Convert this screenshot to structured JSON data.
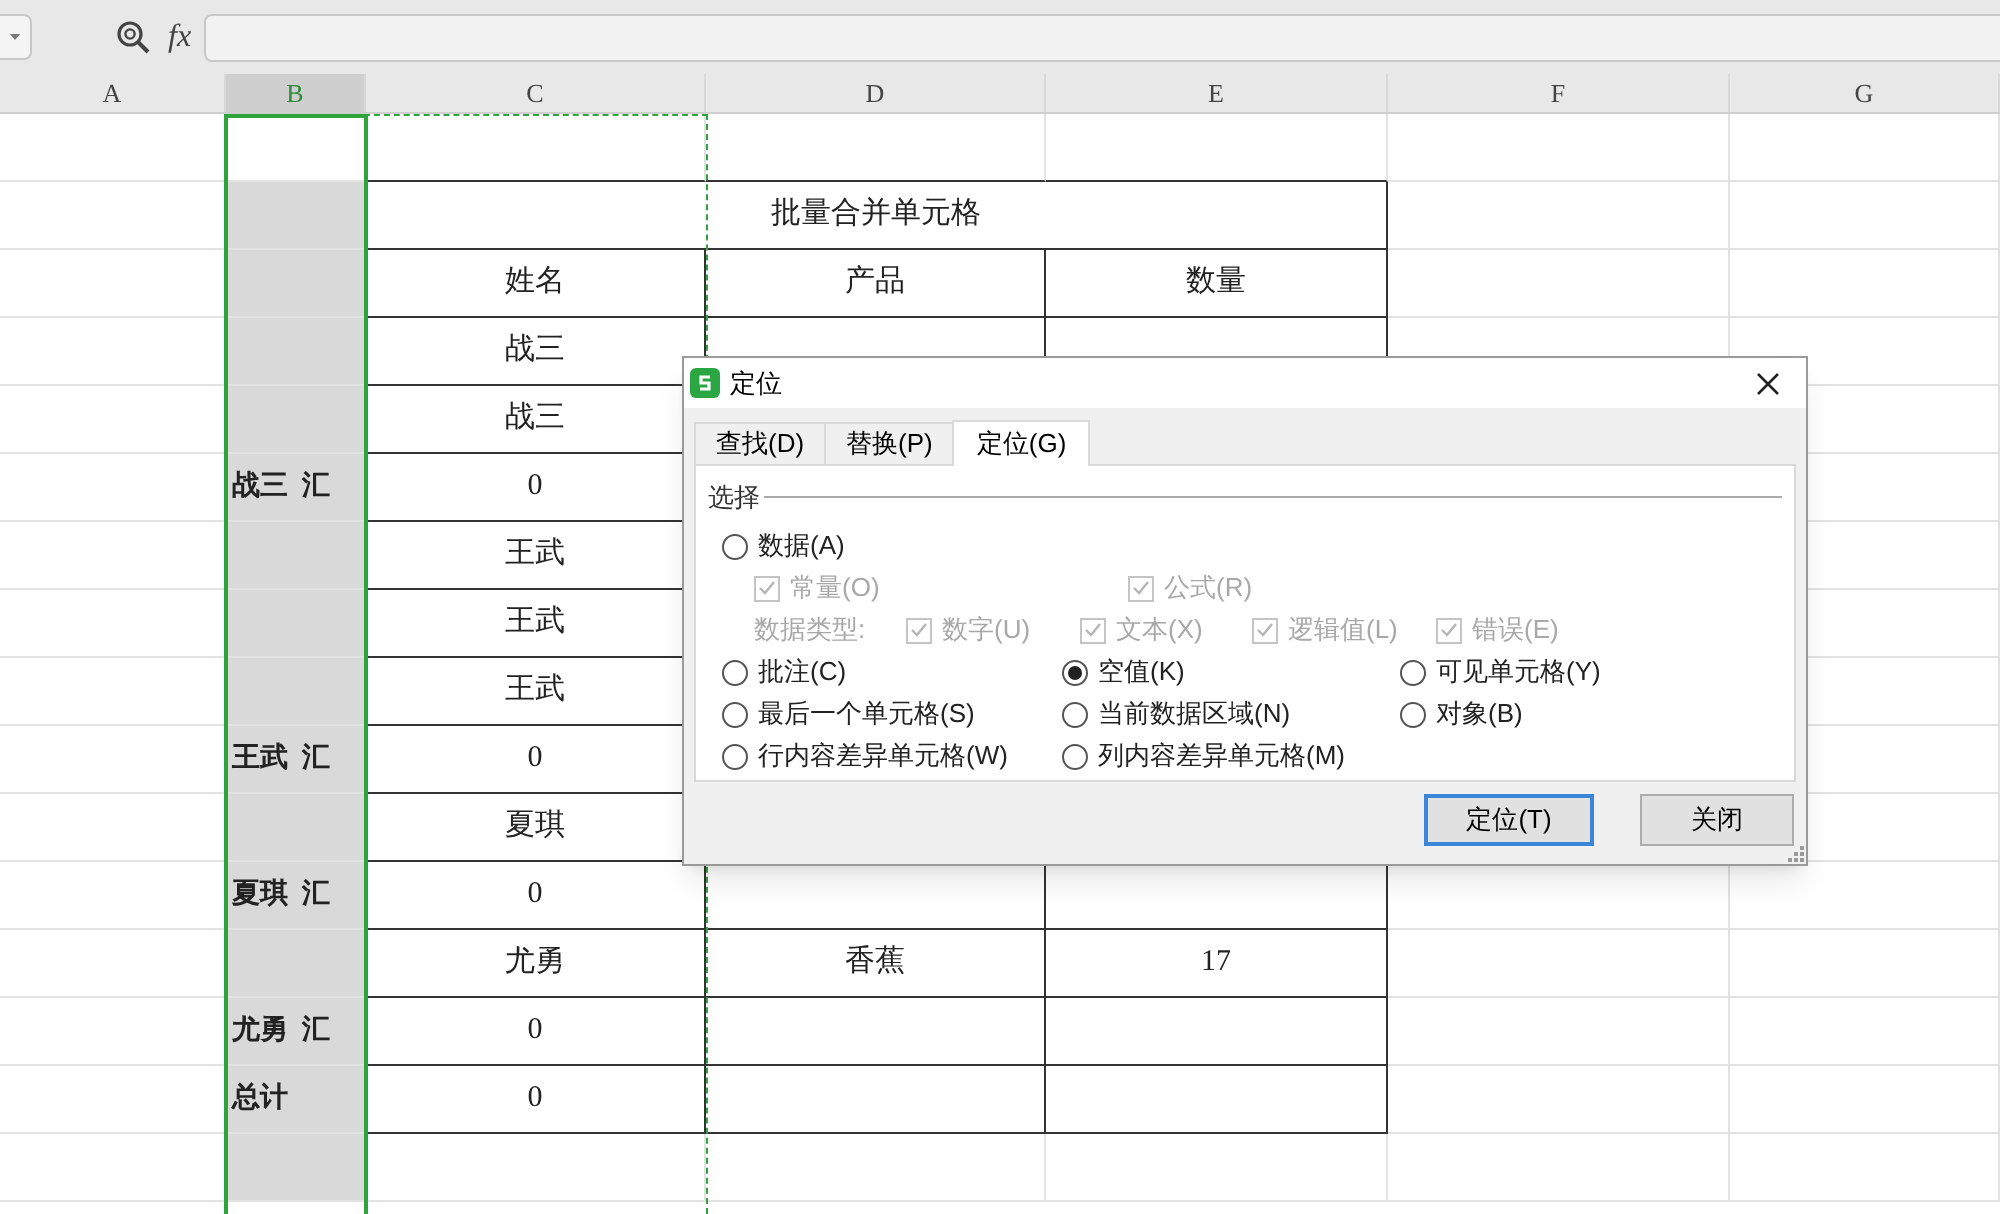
{
  "toolbar": {
    "function_label": "fx"
  },
  "columns": [
    {
      "label": "A",
      "selected": false
    },
    {
      "label": "B",
      "selected": true
    },
    {
      "label": "C",
      "selected": false
    },
    {
      "label": "D",
      "selected": false
    },
    {
      "label": "E",
      "selected": false
    },
    {
      "label": "F",
      "selected": false
    },
    {
      "label": "G",
      "selected": false
    }
  ],
  "rows": [
    {},
    {
      "title": "批量合并单元格"
    },
    {
      "col_c": "姓名",
      "col_d": "产品",
      "col_e": "数量"
    },
    {
      "col_c": "战三"
    },
    {
      "col_c": "战三"
    },
    {
      "col_b": "战三  汇",
      "col_c": "0"
    },
    {
      "col_c": "王武"
    },
    {
      "col_c": "王武"
    },
    {
      "col_c": "王武"
    },
    {
      "col_b": "王武  汇",
      "col_c": "0"
    },
    {
      "col_c": "夏琪"
    },
    {
      "col_b": "夏琪  汇",
      "col_c": "0"
    },
    {
      "col_c": "尤勇",
      "col_d": "香蕉",
      "col_e": "17"
    },
    {
      "col_b": "尤勇  汇",
      "col_c": "0"
    },
    {
      "col_b": "总计",
      "col_c": "0"
    },
    {}
  ],
  "dialog": {
    "title": "定位",
    "tabs": [
      {
        "label": "查找(D)",
        "selected": false
      },
      {
        "label": "替换(P)",
        "selected": false
      },
      {
        "label": "定位(G)",
        "selected": true
      }
    ],
    "group_label": "选择",
    "option_rows": [
      [
        {
          "kind": "radio",
          "label": "数据(A)",
          "selected": false,
          "disabled": false
        }
      ],
      [
        {
          "kind": "checkbox",
          "label": "常量(O)",
          "checked": true,
          "disabled": true
        },
        {
          "kind": "checkbox",
          "label": "公式(R)",
          "checked": true,
          "disabled": true
        }
      ],
      [
        {
          "kind": "label",
          "label": "数据类型:"
        },
        {
          "kind": "checkbox",
          "label": "数字(U)",
          "checked": true,
          "disabled": true
        },
        {
          "kind": "checkbox",
          "label": "文本(X)",
          "checked": true,
          "disabled": true
        },
        {
          "kind": "checkbox",
          "label": "逻辑值(L)",
          "checked": true,
          "disabled": true
        },
        {
          "kind": "checkbox",
          "label": "错误(E)",
          "checked": true,
          "disabled": true
        }
      ],
      [
        {
          "kind": "radio",
          "label": "批注(C)",
          "selected": false,
          "disabled": false
        },
        {
          "kind": "radio",
          "label": "空值(K)",
          "selected": true,
          "disabled": false
        },
        {
          "kind": "radio",
          "label": "可见单元格(Y)",
          "selected": false,
          "disabled": false
        }
      ],
      [
        {
          "kind": "radio",
          "label": "最后一个单元格(S)",
          "selected": false,
          "disabled": false
        },
        {
          "kind": "radio",
          "label": "当前数据区域(N)",
          "selected": false,
          "disabled": false
        },
        {
          "kind": "radio",
          "label": "对象(B)",
          "selected": false,
          "disabled": false
        }
      ],
      [
        {
          "kind": "radio",
          "label": "行内容差异单元格(W)",
          "selected": false,
          "disabled": false
        },
        {
          "kind": "radio",
          "label": "列内容差异单元格(M)",
          "selected": false,
          "disabled": false
        }
      ]
    ],
    "buttons": [
      {
        "label": "定位(T)",
        "default": true
      },
      {
        "label": "关闭",
        "default": false
      }
    ]
  }
}
